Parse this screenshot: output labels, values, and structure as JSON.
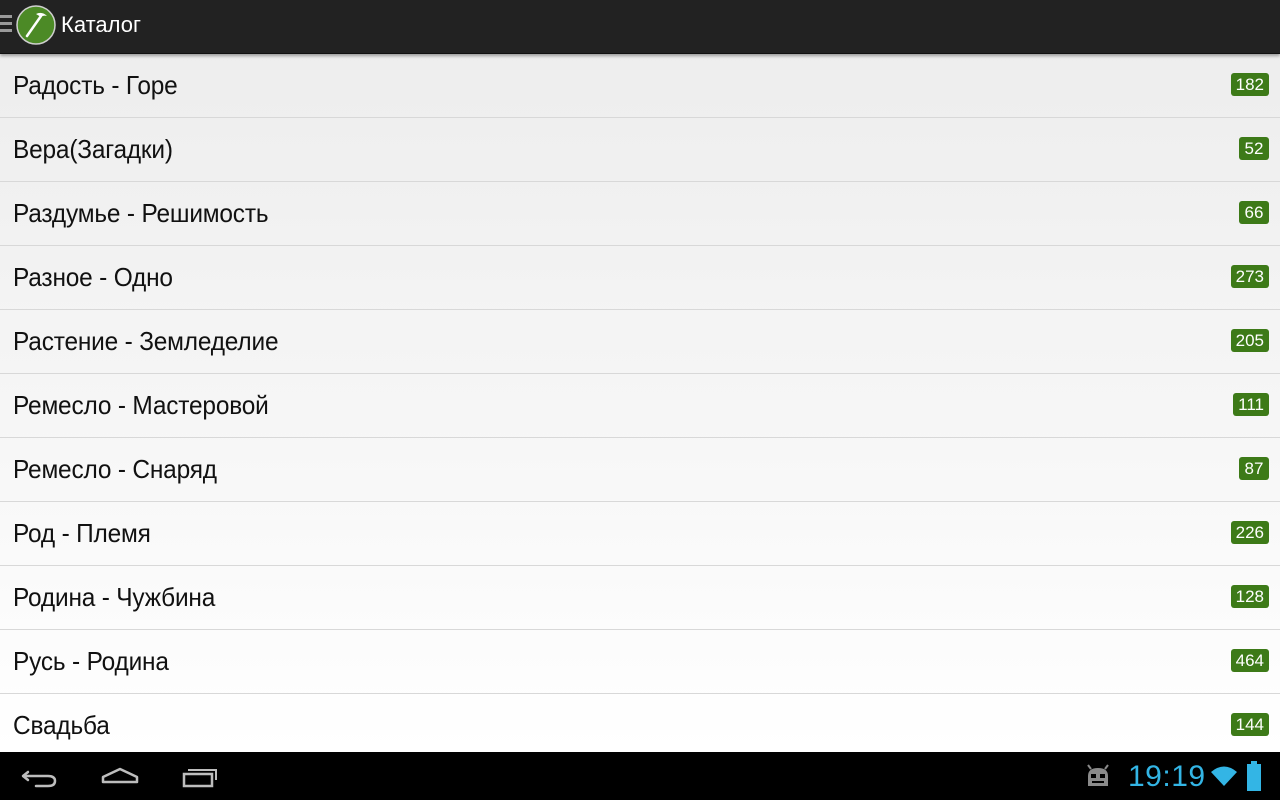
{
  "app": {
    "title": "Каталог",
    "accent_color": "#3d7a18",
    "clock_color": "#33b5e5"
  },
  "catalog": {
    "items": [
      {
        "label": "Радость - Горе",
        "count": "182"
      },
      {
        "label": "Вера(Загадки)",
        "count": "52"
      },
      {
        "label": "Раздумье - Решимость",
        "count": "66"
      },
      {
        "label": "Разное - Одно",
        "count": "273"
      },
      {
        "label": "Растение - Земледелие",
        "count": "205"
      },
      {
        "label": "Ремесло - Мастеровой",
        "count": "111"
      },
      {
        "label": "Ремесло - Снаряд",
        "count": "87"
      },
      {
        "label": "Род - Племя",
        "count": "226"
      },
      {
        "label": "Родина - Чужбина",
        "count": "128"
      },
      {
        "label": "Русь - Родина",
        "count": "464"
      },
      {
        "label": "Свадьба",
        "count": "144"
      }
    ]
  },
  "system_bar": {
    "clock": "19:19",
    "nav_icons": [
      "back-icon",
      "home-icon",
      "recent-apps-icon"
    ],
    "status_icons": [
      "android-debug-icon",
      "wifi-icon",
      "battery-icon"
    ]
  }
}
